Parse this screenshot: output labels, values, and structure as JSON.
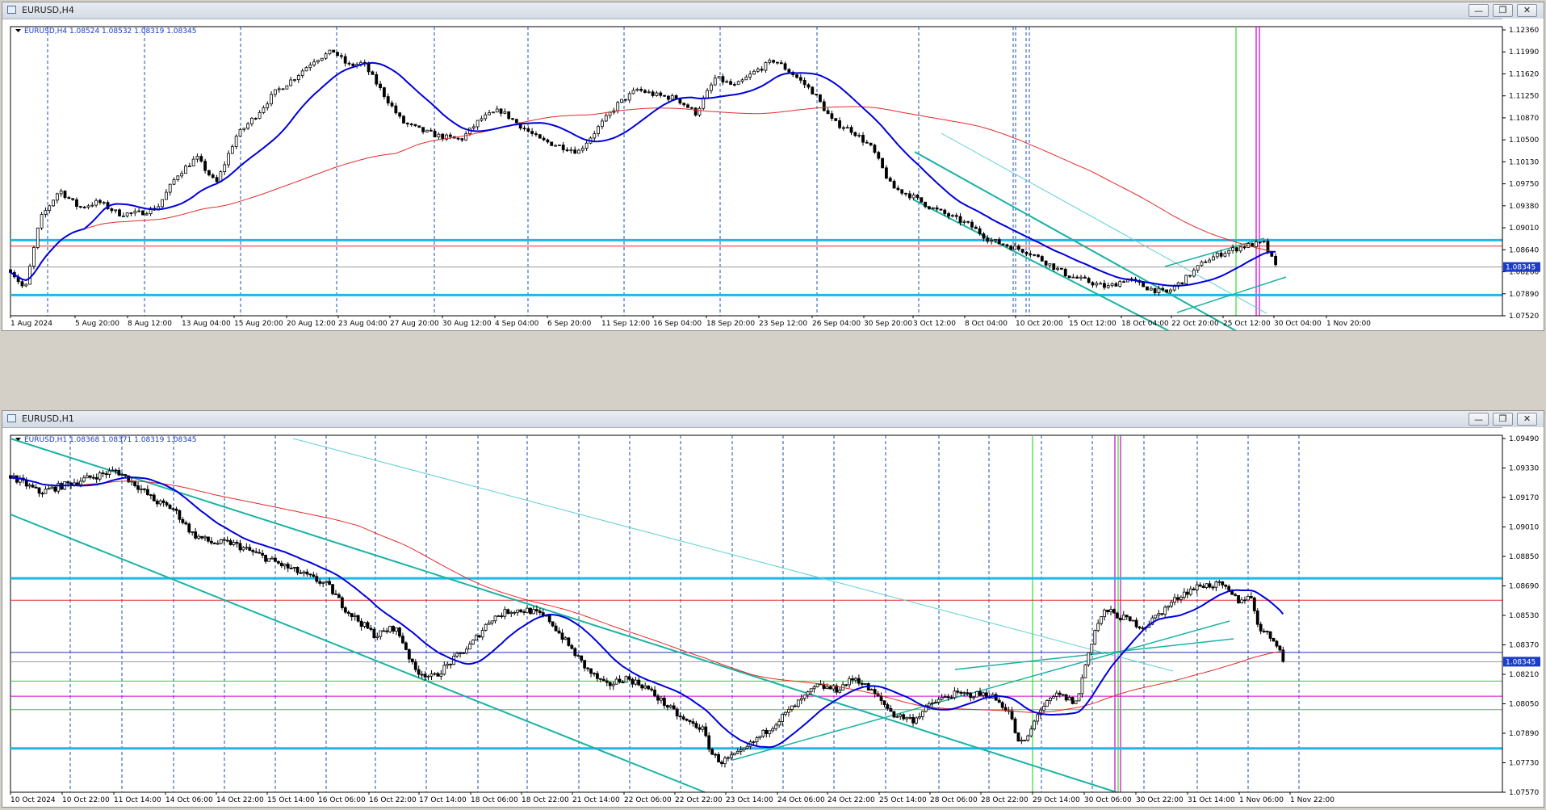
{
  "windows": [
    {
      "title": "EURUSD,H4",
      "info": "EURUSD,H4  1.08524 1.08532 1.08319 1.08345",
      "buttons": [
        "minimize",
        "restore",
        "close"
      ]
    },
    {
      "title": "EURUSD,H1",
      "info": "EURUSD,H1  1.08368 1.08371 1.08319 1.08345",
      "buttons": [
        "minimize",
        "restore",
        "close"
      ]
    }
  ],
  "colors": {
    "candle": "#000000",
    "ma_fast": "#0000dd",
    "ma_slow": "#e52a2a",
    "support_resistance": "#1fb8e6",
    "channel": "#19b3a3",
    "channel_light": "#5fcfd2",
    "vline_green": "#33dd33",
    "vline_magenta": "#cc00cc",
    "price_label_bg": "#1a3cc8",
    "grid_vline": "#1a4fb0"
  },
  "chart_data": [
    {
      "type": "candlestick",
      "symbol": "EURUSD",
      "timeframe": "H4",
      "ylim": [
        1.0752,
        1.1236
      ],
      "y_ticks": [
        "1.12360",
        "1.11990",
        "1.11620",
        "1.11250",
        "1.10870",
        "1.10500",
        "1.10130",
        "1.09750",
        "1.09380",
        "1.09010",
        "1.08640",
        "1.08260",
        "1.07890",
        "1.07520"
      ],
      "x_ticks": [
        "1 Aug 2024",
        "5 Aug 20:00",
        "8 Aug 12:00",
        "13 Aug 04:00",
        "15 Aug 20:00",
        "20 Aug 12:00",
        "23 Aug 04:00",
        "27 Aug 20:00",
        "30 Aug 12:00",
        "4 Sep 04:00",
        "6 Sep 20:00",
        "11 Sep 12:00",
        "16 Sep 04:00",
        "18 Sep 20:00",
        "23 Sep 12:00",
        "26 Sep 04:00",
        "30 Sep 20:00",
        "3 Oct 12:00",
        "8 Oct 04:00",
        "10 Oct 20:00",
        "15 Oct 12:00",
        "18 Oct 04:00",
        "22 Oct 20:00",
        "25 Oct 12:00",
        "30 Oct 04:00",
        "1 Nov 20:00"
      ],
      "current_price": "1.08345",
      "ohlc_last": {
        "open": 1.08524,
        "high": 1.08532,
        "low": 1.08319,
        "close": 1.08345
      },
      "approx_close_path": [
        [
          0,
          1.083
        ],
        [
          0.015,
          1.0795
        ],
        [
          0.03,
          1.0915
        ],
        [
          0.05,
          1.0965
        ],
        [
          0.07,
          1.0935
        ],
        [
          0.09,
          1.0945
        ],
        [
          0.11,
          1.0925
        ],
        [
          0.13,
          1.0925
        ],
        [
          0.15,
          1.0935
        ],
        [
          0.17,
          1.099
        ],
        [
          0.19,
          1.102
        ],
        [
          0.21,
          1.0975
        ],
        [
          0.23,
          1.1055
        ],
        [
          0.25,
          1.109
        ],
        [
          0.27,
          1.113
        ],
        [
          0.29,
          1.1155
        ],
        [
          0.31,
          1.1185
        ],
        [
          0.33,
          1.12
        ],
        [
          0.345,
          1.1175
        ],
        [
          0.36,
          1.118
        ],
        [
          0.38,
          1.113
        ],
        [
          0.4,
          1.108
        ],
        [
          0.42,
          1.1065
        ],
        [
          0.44,
          1.1055
        ],
        [
          0.46,
          1.105
        ],
        [
          0.48,
          1.1085
        ],
        [
          0.5,
          1.11
        ],
        [
          0.52,
          1.1075
        ],
        [
          0.54,
          1.105
        ],
        [
          0.56,
          1.104
        ],
        [
          0.58,
          1.103
        ],
        [
          0.6,
          1.107
        ],
        [
          0.62,
          1.111
        ],
        [
          0.64,
          1.1135
        ],
        [
          0.66,
          1.1125
        ],
        [
          0.68,
          1.112
        ],
        [
          0.7,
          1.1095
        ],
        [
          0.72,
          1.1155
        ],
        [
          0.74,
          1.114
        ],
        [
          0.76,
          1.1165
        ],
        [
          0.78,
          1.1185
        ],
        [
          0.8,
          1.116
        ],
        [
          0.82,
          1.113
        ],
        [
          0.84,
          1.108
        ],
        [
          0.86,
          1.1065
        ],
        [
          0.88,
          1.1035
        ],
        [
          0.9,
          1.097
        ],
        [
          0.92,
          1.0955
        ],
        [
          0.94,
          1.0935
        ],
        [
          0.96,
          1.092
        ],
        [
          0.98,
          1.0905
        ],
        [
          1.0,
          1.088
        ],
        [
          1.02,
          1.087
        ],
        [
          1.04,
          1.086
        ],
        [
          1.06,
          1.084
        ],
        [
          1.08,
          1.082
        ],
        [
          1.1,
          1.081
        ],
        [
          1.12,
          1.08
        ],
        [
          1.14,
          1.0815
        ],
        [
          1.16,
          1.08
        ],
        [
          1.18,
          1.079
        ],
        [
          1.2,
          1.0815
        ],
        [
          1.22,
          1.0845
        ],
        [
          1.24,
          1.086
        ],
        [
          1.26,
          1.087
        ],
        [
          1.28,
          1.0875
        ],
        [
          1.292,
          1.0835
        ]
      ],
      "horizontal_lines": [
        {
          "price": 1.088,
          "color": "#1fb8e6",
          "width": 3
        },
        {
          "price": 1.087,
          "color": "#e52a2a",
          "width": 1
        },
        {
          "price": 1.08345,
          "color": "#9a9a9a",
          "width": 1
        },
        {
          "price": 1.0787,
          "color": "#1fb8e6",
          "width": 3
        }
      ]
    },
    {
      "type": "candlestick",
      "symbol": "EURUSD",
      "timeframe": "H1",
      "ylim": [
        1.0757,
        1.0967
      ],
      "y_ticks": [
        "1.09490",
        "1.09330",
        "1.09170",
        "1.09010",
        "1.08850",
        "1.08690",
        "1.08530",
        "1.08370",
        "1.08210",
        "1.08050",
        "1.07890",
        "1.07730",
        "1.07570"
      ],
      "x_ticks": [
        "10 Oct 2024",
        "10 Oct 22:00",
        "11 Oct 14:00",
        "14 Oct 06:00",
        "14 Oct 22:00",
        "15 Oct 14:00",
        "16 Oct 06:00",
        "16 Oct 22:00",
        "17 Oct 14:00",
        "18 Oct 06:00",
        "18 Oct 22:00",
        "21 Oct 14:00",
        "22 Oct 06:00",
        "22 Oct 22:00",
        "23 Oct 14:00",
        "24 Oct 06:00",
        "24 Oct 22:00",
        "25 Oct 14:00",
        "28 Oct 06:00",
        "28 Oct 22:00",
        "29 Oct 14:00",
        "30 Oct 06:00",
        "30 Oct 22:00",
        "31 Oct 14:00",
        "1 Nov 06:00",
        "1 Nov 22:00"
      ],
      "current_price": "1.08345",
      "ohlc_last": {
        "open": 1.08368,
        "high": 1.08371,
        "low": 1.08319,
        "close": 1.08345
      },
      "approx_close_path": [
        [
          0,
          1.0945
        ],
        [
          0.03,
          1.0935
        ],
        [
          0.06,
          1.094
        ],
        [
          0.09,
          1.0945
        ],
        [
          0.11,
          1.0948
        ],
        [
          0.13,
          1.094
        ],
        [
          0.15,
          1.093
        ],
        [
          0.17,
          1.0925
        ],
        [
          0.19,
          1.091
        ],
        [
          0.21,
          1.0905
        ],
        [
          0.23,
          1.0905
        ],
        [
          0.25,
          1.09
        ],
        [
          0.27,
          1.0895
        ],
        [
          0.29,
          1.089
        ],
        [
          0.31,
          1.0885
        ],
        [
          0.33,
          1.088
        ],
        [
          0.35,
          1.0865
        ],
        [
          0.37,
          1.0855
        ],
        [
          0.38,
          1.085
        ],
        [
          0.4,
          1.0855
        ],
        [
          0.41,
          1.0845
        ],
        [
          0.42,
          1.083
        ],
        [
          0.44,
          1.0825
        ],
        [
          0.46,
          1.0835
        ],
        [
          0.48,
          1.0845
        ],
        [
          0.5,
          1.086
        ],
        [
          0.52,
          1.0865
        ],
        [
          0.54,
          1.0865
        ],
        [
          0.56,
          1.086
        ],
        [
          0.58,
          1.0845
        ],
        [
          0.6,
          1.083
        ],
        [
          0.62,
          1.082
        ],
        [
          0.64,
          1.0825
        ],
        [
          0.66,
          1.082
        ],
        [
          0.68,
          1.081
        ],
        [
          0.7,
          1.08
        ],
        [
          0.72,
          1.0795
        ],
        [
          0.73,
          1.078
        ],
        [
          0.74,
          1.0775
        ],
        [
          0.76,
          1.078
        ],
        [
          0.78,
          1.079
        ],
        [
          0.8,
          1.08
        ],
        [
          0.82,
          1.081
        ],
        [
          0.84,
          1.082
        ],
        [
          0.86,
          1.0818
        ],
        [
          0.88,
          1.0825
        ],
        [
          0.9,
          1.0815
        ],
        [
          0.92,
          1.0803
        ],
        [
          0.94,
          1.08
        ],
        [
          0.96,
          1.081
        ],
        [
          0.98,
          1.0815
        ],
        [
          1.0,
          1.0815
        ],
        [
          1.02,
          1.0815
        ],
        [
          1.04,
          1.0805
        ],
        [
          1.05,
          1.0785
        ],
        [
          1.06,
          1.079
        ],
        [
          1.07,
          1.0805
        ],
        [
          1.09,
          1.0815
        ],
        [
          1.11,
          1.081
        ],
        [
          1.12,
          1.0835
        ],
        [
          1.13,
          1.0855
        ],
        [
          1.14,
          1.0865
        ],
        [
          1.16,
          1.086
        ],
        [
          1.18,
          1.0855
        ],
        [
          1.2,
          1.0865
        ],
        [
          1.22,
          1.0875
        ],
        [
          1.24,
          1.088
        ],
        [
          1.26,
          1.088
        ],
        [
          1.27,
          1.0875
        ],
        [
          1.28,
          1.087
        ],
        [
          1.29,
          1.0875
        ],
        [
          1.3,
          1.0855
        ],
        [
          1.31,
          1.085
        ],
        [
          1.32,
          1.0845
        ],
        [
          1.325,
          1.0834
        ]
      ],
      "horizontal_lines": [
        {
          "price": 1.0884,
          "color": "#1fb8e6",
          "width": 3
        },
        {
          "price": 1.0871,
          "color": "#e52a2a",
          "width": 1
        },
        {
          "price": 1.084,
          "color": "#2233aa",
          "width": 1
        },
        {
          "price": 1.08345,
          "color": "#9a9a9a",
          "width": 1
        },
        {
          "price": 1.0823,
          "color": "#33cc33",
          "width": 1
        },
        {
          "price": 1.0814,
          "color": "#cc00cc",
          "width": 1
        },
        {
          "price": 1.0806,
          "color": "#33cc33",
          "width": 1
        },
        {
          "price": 1.0783,
          "color": "#1fb8e6",
          "width": 3
        }
      ]
    }
  ]
}
